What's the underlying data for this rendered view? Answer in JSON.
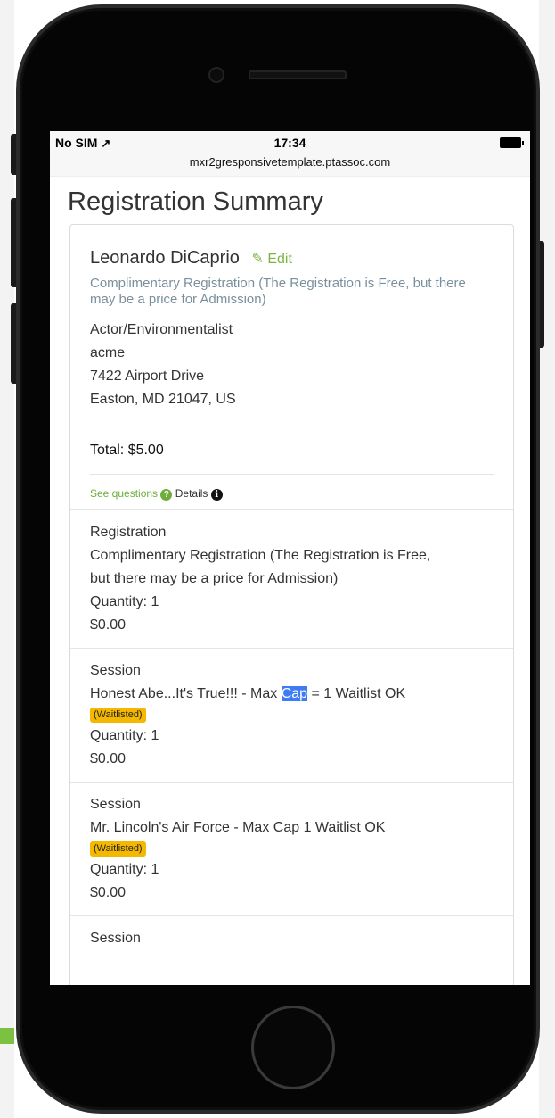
{
  "status_bar": {
    "carrier": "No SIM",
    "time": "17:34",
    "url": "mxr2gresponsivetemplate.ptassoc.com"
  },
  "page": {
    "title": "Registration Summary"
  },
  "registrant": {
    "name": "Leonardo DiCaprio",
    "edit_label": "Edit",
    "reg_type": "Complimentary Registration (The Registration is Free, but there may be a price for Admission)",
    "title_line": "Actor/Environmentalist",
    "company": "acme",
    "street": "7422 Airport Drive",
    "city_line": "Easton, MD 21047, US",
    "total": "Total: $5.00",
    "see_questions": "See questions",
    "details": "Details"
  },
  "items": [
    {
      "category": "Registration",
      "line1": "Complimentary Registration (The Registration is Free,",
      "line2": "but there may be a price for Admission)",
      "quantity": "Quantity: 1",
      "price": "$0.00"
    },
    {
      "category": "Session",
      "name_before": "Honest Abe...It's True!!! - Max ",
      "name_highlight": "Cap",
      "name_after": " = 1 Waitlist OK",
      "badge": "(Waitlisted)",
      "quantity": "Quantity: 1",
      "price": "$0.00"
    },
    {
      "category": "Session",
      "name": "Mr. Lincoln's Air Force - Max Cap 1 Waitlist OK",
      "badge": "(Waitlisted)",
      "quantity": "Quantity: 1",
      "price": "$0.00"
    },
    {
      "category": "Session"
    }
  ]
}
